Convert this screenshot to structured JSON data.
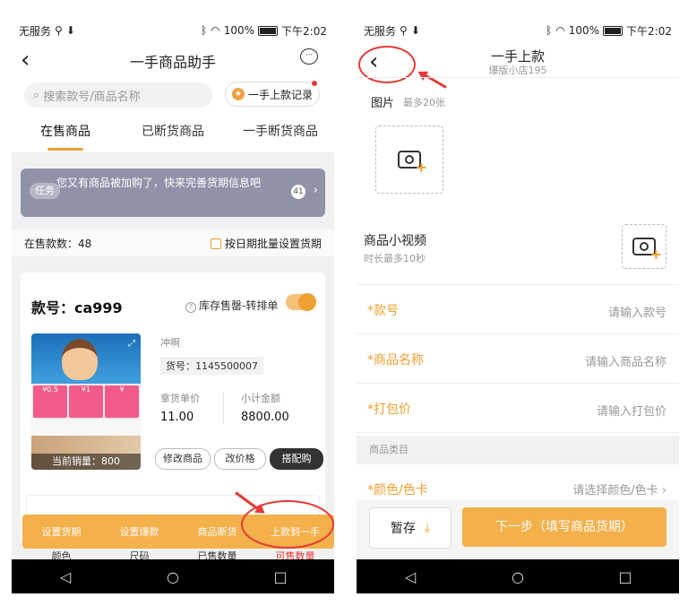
{
  "left": {
    "status": {
      "carrier": "无服务",
      "battery": "100%",
      "time": "下午2:02"
    },
    "title": "一手商品助手",
    "search": {
      "placeholder": "搜索款号/商品名称"
    },
    "record_button": "一手上款记录",
    "tabs": [
      {
        "label": "在售商品",
        "active": true
      },
      {
        "label": "已断货商品",
        "active": false
      },
      {
        "label": "一手断货商品",
        "active": false
      }
    ],
    "task": {
      "tag": "任务",
      "text": "您又有商品被加购了，快来完善货期信息吧",
      "count": "41"
    },
    "summary": {
      "count_text": "在售款数：48",
      "batch_button": "按日期批量设置货期"
    },
    "card": {
      "sku": "款号：ca999",
      "soldout_label": "库存售罄-转排单",
      "brand": "冲啊",
      "goods_no": "货号：1145500007",
      "unit_price_label": "拿货单价",
      "unit_price": "11.00",
      "subtotal_label": "小计金额",
      "subtotal": "8800.00",
      "current_sales": "当前销量：800",
      "thumb_prices": [
        "¥0.5",
        "¥1",
        "¥"
      ],
      "buttons": {
        "edit_product": "修改商品",
        "edit_price": "改价格",
        "match": "搭配购"
      }
    },
    "action_bar": [
      "设置货期",
      "设置爆款",
      "商品断货",
      "上款到一手"
    ],
    "table_headers": [
      "颜色",
      "尺码",
      "已售数量",
      "可售数量"
    ]
  },
  "right": {
    "status": {
      "carrier": "无服务",
      "battery": "100%",
      "time": "下午2:02"
    },
    "title": "一手上款",
    "subtitle": "爆版小店195",
    "photo_label": "图片",
    "photo_hint": "最多20张",
    "video_label": "商品小视频",
    "video_hint": "时长最多10秒",
    "fields": [
      {
        "label": "*款号",
        "placeholder": "请输入款号"
      },
      {
        "label": "*商品名称",
        "placeholder": "请输入商品名称"
      },
      {
        "label": "*打包价",
        "placeholder": "请输入打包价"
      }
    ],
    "category_label": "商品类目",
    "color_field": {
      "label": "*颜色/色卡",
      "placeholder": "请选择颜色/色卡"
    },
    "save_button": "暂存",
    "next_button": "下一步（填写商品货期）"
  },
  "colors": {
    "accent": "#f0a030",
    "annotation": "#e53935",
    "task_bg": "#9092a8"
  }
}
